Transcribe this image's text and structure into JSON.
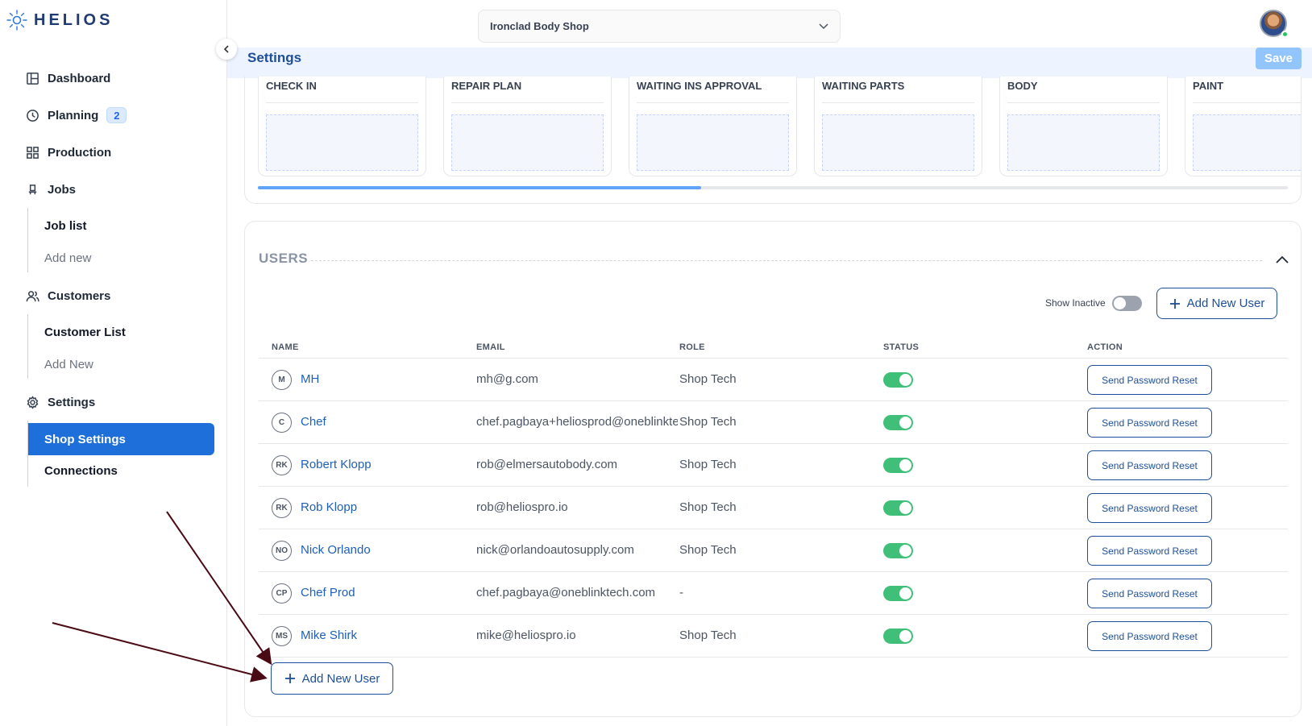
{
  "brand": {
    "name": "HELIOS"
  },
  "header": {
    "shop_name": "Ironclad Body Shop",
    "settings_title": "Settings",
    "save_label": "Save"
  },
  "sidebar": {
    "dashboard": "Dashboard",
    "planning": "Planning",
    "planning_badge": "2",
    "production": "Production",
    "jobs": "Jobs",
    "job_list": "Job list",
    "jobs_add_new": "Add new",
    "customers": "Customers",
    "customer_list": "Customer List",
    "customers_add_new": "Add New",
    "settings": "Settings",
    "shop_settings": "Shop Settings",
    "connections": "Connections"
  },
  "workflow": {
    "stages": [
      "CHECK IN",
      "REPAIR PLAN",
      "WAITING INS APPROVAL",
      "WAITING PARTS",
      "BODY",
      "PAINT"
    ],
    "scroll_fraction": 0.43
  },
  "users": {
    "title": "USERS",
    "show_inactive_label": "Show Inactive",
    "add_new_user_label": "Add New User",
    "columns": {
      "name": "NAME",
      "email": "EMAIL",
      "role": "ROLE",
      "status": "STATUS",
      "action": "ACTION"
    },
    "reset_label": "Send Password Reset",
    "rows": [
      {
        "initials": "M",
        "name": "MH",
        "email": "mh@g.com",
        "role": "Shop Tech",
        "active": true
      },
      {
        "initials": "C",
        "name": "Chef",
        "email": "chef.pagbaya+heliosprod@oneblinktech.com",
        "role": "Shop Tech",
        "active": true
      },
      {
        "initials": "RK",
        "name": "Robert Klopp",
        "email": "rob@elmersautobody.com",
        "role": "Shop Tech",
        "active": true
      },
      {
        "initials": "RK",
        "name": "Rob Klopp",
        "email": "rob@heliospro.io",
        "role": "Shop Tech",
        "active": true
      },
      {
        "initials": "NO",
        "name": "Nick Orlando",
        "email": "nick@orlandoautosupply.com",
        "role": "Shop Tech",
        "active": true
      },
      {
        "initials": "CP",
        "name": "Chef Prod",
        "email": "chef.pagbaya@oneblinktech.com",
        "role": "-",
        "active": true
      },
      {
        "initials": "MS",
        "name": "Mike Shirk",
        "email": "mike@heliospro.io",
        "role": "Shop Tech",
        "active": true
      }
    ]
  },
  "colors": {
    "primary": "#1e6fd9",
    "accent_dark": "#1e4f99",
    "toggle_on": "#3fbf78",
    "annotation_arrow": "#4a0a14"
  }
}
